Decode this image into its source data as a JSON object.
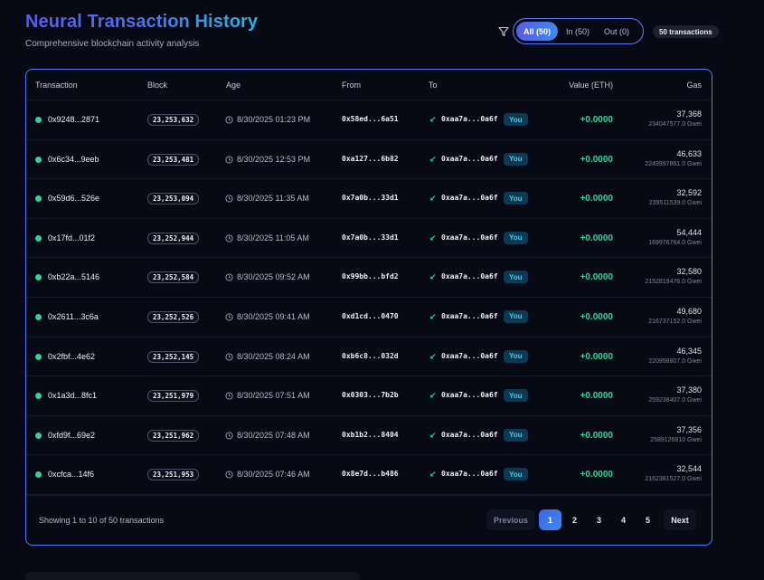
{
  "header": {
    "title": "Neural Transaction History",
    "subtitle": "Comprehensive blockchain activity analysis"
  },
  "filters": {
    "icon": "filter-icon",
    "all_label": "All (50)",
    "in_label": "In (50)",
    "out_label": "Out (0)",
    "count_badge": "50 transactions"
  },
  "table": {
    "columns": {
      "transaction": "Transaction",
      "block": "Block",
      "age": "Age",
      "from": "From",
      "to": "To",
      "value": "Value (ETH)",
      "gas": "Gas"
    },
    "you_label": "You",
    "rows": [
      {
        "hash": "0x9248...2871",
        "block": "23,253,632",
        "age": "8/30/2025 01:23 PM",
        "from": "0x58ed...6a51",
        "to": "0xaa7a...0a6f",
        "value": "+0.0000",
        "gas": "37,368",
        "gwei": "234047577.0 Gwei"
      },
      {
        "hash": "0x6c34...9eeb",
        "block": "23,253,481",
        "age": "8/30/2025 12:53 PM",
        "from": "0xa127...6b82",
        "to": "0xaa7a...0a6f",
        "value": "+0.0000",
        "gas": "46,633",
        "gwei": "2249997861.0 Gwei"
      },
      {
        "hash": "0x59d6...526e",
        "block": "23,253,094",
        "age": "8/30/2025 11:35 AM",
        "from": "0x7a0b...33d1",
        "to": "0xaa7a...0a6f",
        "value": "+0.0000",
        "gas": "32,592",
        "gwei": "239511539.0 Gwei"
      },
      {
        "hash": "0x17fd...01f2",
        "block": "23,252,944",
        "age": "8/30/2025 11:05 AM",
        "from": "0x7a0b...33d1",
        "to": "0xaa7a...0a6f",
        "value": "+0.0000",
        "gas": "54,444",
        "gwei": "169976764.0 Gwei"
      },
      {
        "hash": "0xb22a...5146",
        "block": "23,252,584",
        "age": "8/30/2025 09:52 AM",
        "from": "0x99bb...bfd2",
        "to": "0xaa7a...0a6f",
        "value": "+0.0000",
        "gas": "32,580",
        "gwei": "2152819476.0 Gwei"
      },
      {
        "hash": "0x2611...3c6a",
        "block": "23,252,526",
        "age": "8/30/2025 09:41 AM",
        "from": "0xd1cd...0470",
        "to": "0xaa7a...0a6f",
        "value": "+0.0000",
        "gas": "49,680",
        "gwei": "216737152.0 Gwei"
      },
      {
        "hash": "0x2fbf...4e62",
        "block": "23,252,145",
        "age": "8/30/2025 08:24 AM",
        "from": "0xb6c8...032d",
        "to": "0xaa7a...0a6f",
        "value": "+0.0000",
        "gas": "46,345",
        "gwei": "220958807.0 Gwei"
      },
      {
        "hash": "0x1a3d...8fc1",
        "block": "23,251,979",
        "age": "8/30/2025 07:51 AM",
        "from": "0x0303...7b2b",
        "to": "0xaa7a...0a6f",
        "value": "+0.0000",
        "gas": "37,380",
        "gwei": "259238407.0 Gwei"
      },
      {
        "hash": "0xfd9f...69e2",
        "block": "23,251,962",
        "age": "8/30/2025 07:48 AM",
        "from": "0xb1b2...8404",
        "to": "0xaa7a...0a6f",
        "value": "+0.0000",
        "gas": "37,356",
        "gwei": "2589126810 Gwei"
      },
      {
        "hash": "0xcfca...14f6",
        "block": "23,251,953",
        "age": "8/30/2025 07:46 AM",
        "from": "0x8e7d...b486",
        "to": "0xaa7a...0a6f",
        "value": "+0.0000",
        "gas": "32,544",
        "gwei": "2162381527.0 Gwei"
      }
    ]
  },
  "pagination": {
    "showing": "Showing 1 to 10 of 50 transactions",
    "previous": "Previous",
    "pages": [
      "1",
      "2",
      "3",
      "4",
      "5"
    ],
    "active_page": "1",
    "next": "Next"
  },
  "colors": {
    "accent": "#4f7ff2",
    "incoming": "#2ad69c",
    "you_badge": "#49c6ee"
  }
}
